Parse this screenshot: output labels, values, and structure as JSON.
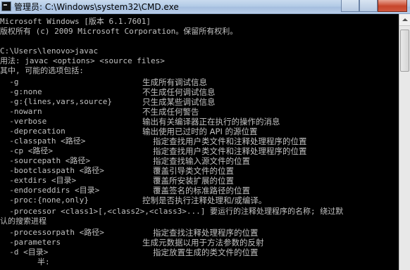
{
  "window": {
    "title": "管理员: C:\\Windows\\system32\\CMD.exe",
    "icon": "cmd-console-icon"
  },
  "console": {
    "header_lines": [
      "Microsoft Windows [版本 6.1.7601]",
      "版权所有 (c) 2009 Microsoft Corporation。保留所有权利。",
      "",
      "C:\\Users\\lenovo>javac",
      "用法: javac <options> <source files>",
      "其中, 可能的选项包括:"
    ],
    "options": [
      {
        "flag": "  -g",
        "desc": "生成所有调试信息"
      },
      {
        "flag": "  -g:none",
        "desc": "不生成任何调试信息"
      },
      {
        "flag": "  -g:{lines,vars,source}",
        "desc": "只生成某些调试信息"
      },
      {
        "flag": "  -nowarn",
        "desc": "不生成任何警告"
      },
      {
        "flag": "  -verbose",
        "desc": "输出有关编译器正在执行的操作的消息"
      },
      {
        "flag": "  -deprecation",
        "desc": "输出使用已过时的 API 的源位置"
      },
      {
        "flag": "  -classpath <路径>",
        "desc": "指定查找用户类文件和注释处理程序的位置"
      },
      {
        "flag": "  -cp <路径>",
        "desc": "指定查找用户类文件和注释处理程序的位置"
      },
      {
        "flag": "  -sourcepath <路径>",
        "desc": "指定查找输入源文件的位置"
      },
      {
        "flag": "  -bootclasspath <路径>",
        "desc": "覆盖引导类文件的位置"
      },
      {
        "flag": "  -extdirs <目录>",
        "desc": "覆盖所安装扩展的位置"
      },
      {
        "flag": "  -endorseddirs <目录>",
        "desc": "覆盖签名的标准路径的位置"
      },
      {
        "flag": "  -proc:{none,only}",
        "desc": "控制是否执行注释处理和/或编译。"
      }
    ],
    "processor_line": "  -processor <class1>[,<class2>,<class3>...] 要运行的注释处理程序的名称; 绕过默",
    "processor_wrap": "认的搜索进程",
    "options_after": [
      {
        "flag": "  -processorpath <路径>",
        "desc": "指定查找注释处理程序的位置"
      },
      {
        "flag": "  -parameters",
        "desc": "生成元数据以用于方法参数的反射"
      },
      {
        "flag": "  -d <目录>",
        "desc": "指定放置生成的类文件的位置"
      }
    ],
    "input_line": "        半:"
  }
}
